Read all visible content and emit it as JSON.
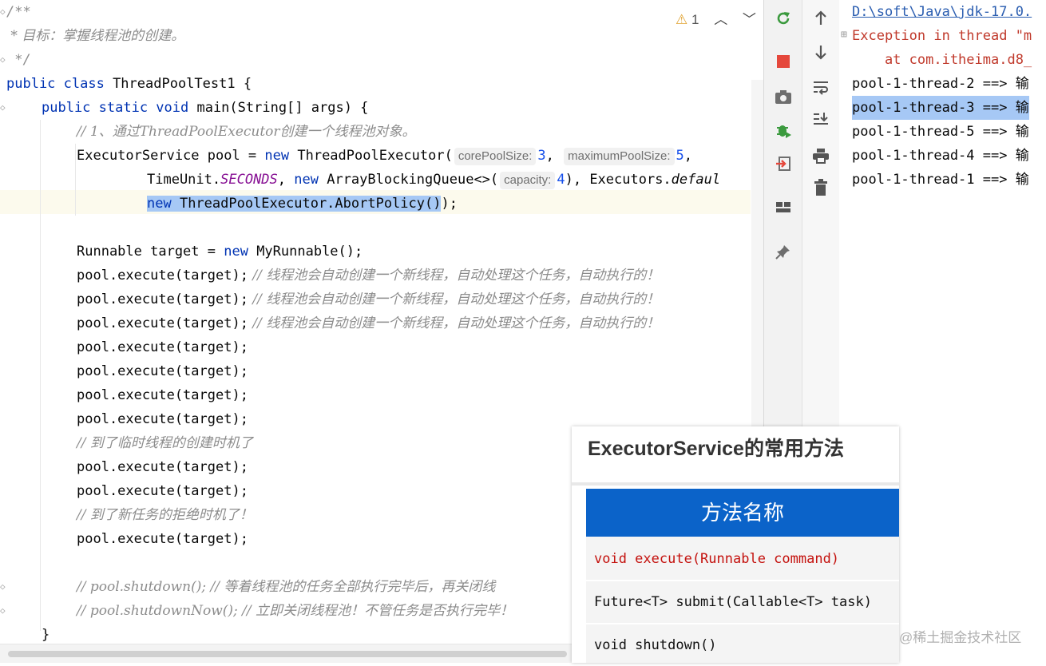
{
  "editor": {
    "warnings": {
      "count": "1"
    },
    "lines": {
      "l1": "/**",
      "l2": " * 目标：掌握线程池的创建。",
      "l3": " */",
      "l4_kw": "public class ",
      "l4_name": "ThreadPoolTest1 {",
      "l5_kw": "public static void ",
      "l5_rest": "main(String[] args) {",
      "l6": "// 1、通过ThreadPoolExecutor创建一个线程池对象。",
      "l7_a": "ExecutorService pool = ",
      "l7_new": "new ",
      "l7_b": "ThreadPoolExecutor(",
      "l7_hint1": "corePoolSize:",
      "l7_val1": "3",
      "l7_c": ",",
      "l7_hint2": "maximumPoolSize:",
      "l7_val2": "5",
      "l7_d": ",",
      "l8_a": "TimeUnit.",
      "l8_enum": "SECONDS",
      "l8_b": ", ",
      "l8_new": "new ",
      "l8_c": "ArrayBlockingQueue<>(",
      "l8_hint": "capacity:",
      "l8_val": "4",
      "l8_d": "), Executors.",
      "l8_e": "defaul",
      "l9_new": "new ",
      "l9_sel": "ThreadPoolExecutor.AbortPolicy()",
      "l9_end": ");",
      "l11_a": "Runnable target = ",
      "l11_new": "new ",
      "l11_b": "MyRunnable();",
      "exec": "pool.execute(target);",
      "exec_comment": " // 线程池会自动创建一个新线程，自动处理这个任务，自动执行的！",
      "c_temp": "// 到了临时线程的创建时机了",
      "c_reject": "// 到了新任务的拒绝时机了！",
      "c_shutdown": "// pool.shutdown(); // 等着线程池的任务全部执行完毕后，再关闭线",
      "c_shutdownnow": "// pool.shutdownNow(); // 立即关闭线程池！不管任务是否执行完毕！",
      "close": "}"
    }
  },
  "console": {
    "lines": [
      "D:\\soft\\Java\\jdk-17.0.",
      "Exception in thread \"m",
      "    at com.itheima.d8_",
      "pool-1-thread-2 ==> 输",
      "pool-1-thread-3 ==> 输",
      "pool-1-thread-5 ==> 输",
      "pool-1-thread-4 ==> 输",
      "pool-1-thread-1 ==> 输"
    ]
  },
  "slide": {
    "title": "ExecutorService的常用方法",
    "table_header": "方法名称",
    "rows": [
      "void execute(Runnable command)",
      "Future<T> submit(Callable<T> task)",
      "void shutdown()"
    ]
  },
  "watermark": "@稀土掘金技术社区",
  "colors": {
    "keyword": "#0033b3",
    "comment": "#8c8c8c",
    "selection": "#a6c8f5",
    "table_header": "#0b63c9",
    "red_text": "#c4120e"
  }
}
